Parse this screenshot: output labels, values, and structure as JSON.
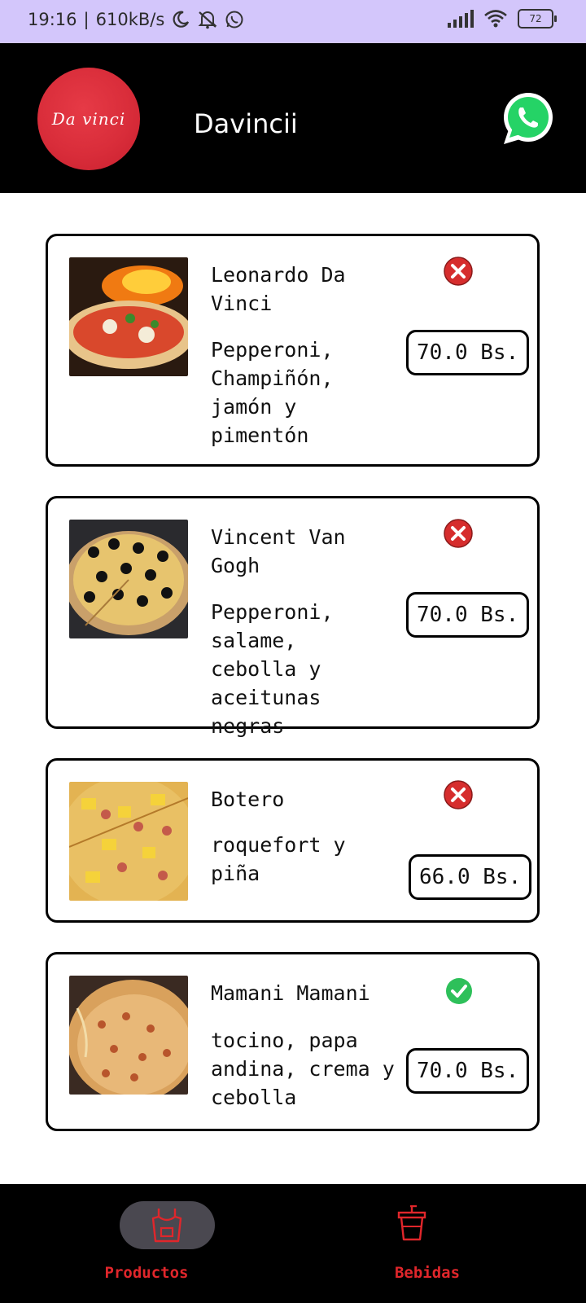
{
  "status_bar": {
    "time": "19:16",
    "separator": "|",
    "speed": "610kB/s",
    "battery": "72"
  },
  "app_bar": {
    "logo_text": "Da vinci",
    "title": "Davincii"
  },
  "products": [
    {
      "name": "Leonardo Da Vinci",
      "description": "Pepperoni, Champiñón, jamón y pimentón",
      "price": "70.0 Bs.",
      "available": false
    },
    {
      "name": "Vincent Van Gogh",
      "description": "Pepperoni, salame, cebolla y aceitunas negras",
      "price": "70.0 Bs.",
      "available": false
    },
    {
      "name": "Botero",
      "description": "roquefort y piña",
      "price": "66.0 Bs.",
      "available": false
    },
    {
      "name": "Mamani Mamani",
      "description": "tocino, papa andina, crema y cebolla",
      "price": "70.0 Bs.",
      "available": true
    }
  ],
  "bottom_nav": {
    "items": [
      {
        "label": "Productos",
        "icon": "apron-icon",
        "selected": true
      },
      {
        "label": "Bebidas",
        "icon": "drink-cup-icon",
        "selected": false
      }
    ]
  },
  "colors": {
    "status_bar_bg": "#d3c6fb",
    "app_bar_bg": "#000000",
    "accent_red": "#e0262b",
    "unavailable_red": "#d62d2d",
    "available_green": "#2ec05a",
    "whatsapp_green": "#25d366"
  }
}
